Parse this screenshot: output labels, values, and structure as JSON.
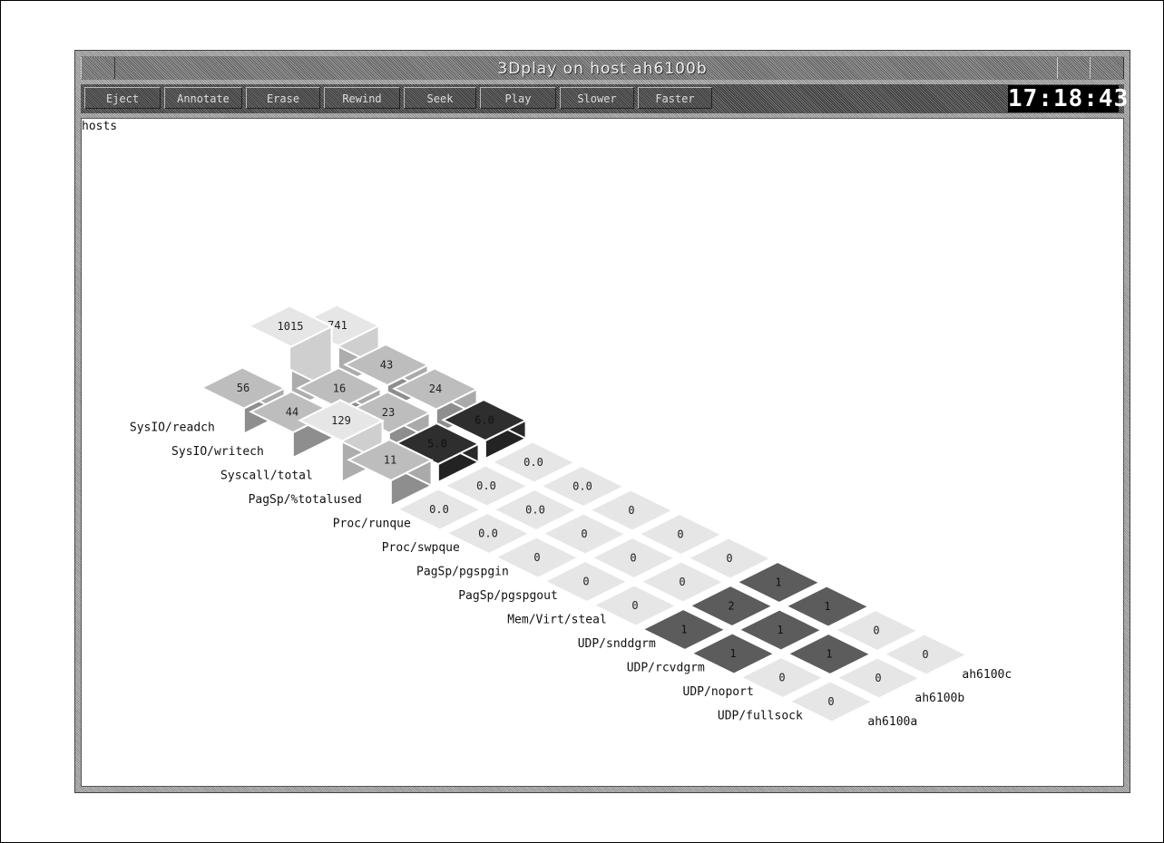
{
  "window": {
    "title": "3Dplay on host ah6100b",
    "clock": "17:18:43"
  },
  "toolbar": {
    "buttons": [
      "Eject",
      "Annotate",
      "Erase",
      "Rewind",
      "Seek",
      "Play",
      "Slower",
      "Faster"
    ]
  },
  "canvas": {
    "label": "hosts"
  },
  "chart_data": {
    "type": "heatmap",
    "rows": [
      "SysIO/readch",
      "SysIO/writech",
      "Syscall/total",
      "PagSp/%totalused",
      "Proc/runque",
      "Proc/swpque",
      "PagSp/pgspgin",
      "PagSp/pgspgout",
      "Mem/Virt/steal",
      "UDP/snddgrm",
      "UDP/rcvdgrm",
      "UDP/noport",
      "UDP/fullsock"
    ],
    "columns": [
      "ah6100a",
      "ah6100b",
      "ah6100c"
    ],
    "values": [
      [
        "56",
        "1015",
        "741"
      ],
      [
        "44",
        "16",
        "43"
      ],
      [
        "129",
        "23",
        "24"
      ],
      [
        "11",
        "5.0",
        "6.0"
      ],
      [
        "0.0",
        "0.0",
        "0.0"
      ],
      [
        "0.0",
        "0.0",
        "0.0"
      ],
      [
        "0",
        "0",
        "0"
      ],
      [
        "0",
        "0",
        "0"
      ],
      [
        "0",
        "0",
        "0"
      ],
      [
        "1",
        "2",
        "1"
      ],
      [
        "1",
        "1",
        "1"
      ],
      [
        "0",
        "1",
        "0"
      ],
      [
        "0",
        "0",
        "0"
      ]
    ],
    "colors": {
      "light": "#e6e6e6",
      "mid": "#bdbdbd",
      "dark": "#5c5c5c",
      "darkest": "#2e2e2e"
    }
  }
}
